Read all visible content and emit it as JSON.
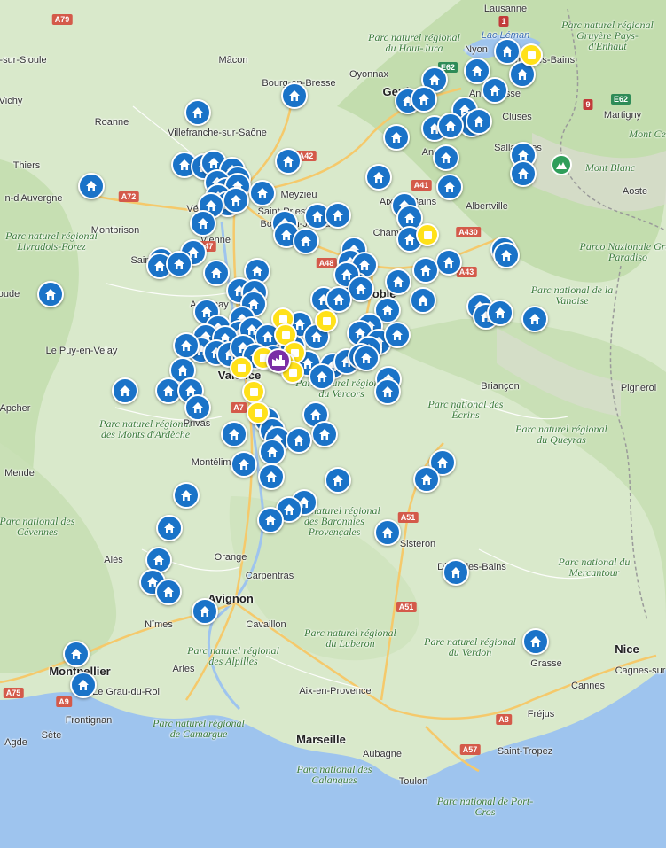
{
  "labels": {
    "lausanne": "Lausanne",
    "nyon": "Nyon",
    "thonon": "Thonon-les-Bains",
    "lac_leman": "Lac Léman",
    "parc_gruyere": "Parc naturel régional Gruyère Pays-d'Enhaut",
    "macon": "Mâcon",
    "oyonnax": "Oyonnax",
    "parc_jura": "Parc naturel régional du Haut-Jura",
    "bourg": "Bourg-en-Bresse",
    "geneve": "Genève",
    "annemasse": "Annemasse",
    "martigny": "Martigny",
    "sioule": "-sur-Sioule",
    "vichy": "Vichy",
    "roanne": "Roanne",
    "villefranche": "Villefranche-sur-Saône",
    "cluses": "Cluses",
    "mont_cervin": "Mont Cerv",
    "thiers": "Thiers",
    "sallanches": "Sallanches",
    "annecy": "Annecy",
    "mont_blanc": "Mont Blanc",
    "meyzieu": "Meyzieu",
    "d_auvergne": "n-d'Auvergne",
    "saint_priest": "Saint-Priest",
    "venissieux": "Vénissieux",
    "aix_bains": "Aix-les-Bains",
    "albertville": "Albertville",
    "aoste": "Aoste",
    "bourgoin": "Bourgoin-Jallieu",
    "parc_livradois": "Parc naturel régional Livradois-Forez",
    "montbrison": "Montbrison",
    "vienne": "Vienne",
    "chambery": "Chambéry",
    "parco_gran": "Parco Nazionale Gran Paradiso",
    "saint_etienne": "Saint",
    "voiron": "Voiron",
    "parc_vanoise": "Parc national de la Vanoise",
    "annonay": "Annonay",
    "grenoble": "Grenoble",
    "le_puy": "Le Puy-en-Velay",
    "parc_vercors": "Parc naturel régional du Vercors",
    "valence": "Valence",
    "briancon": "Briançon",
    "pignerol": "Pignerol",
    "aubenas": "Aubenas",
    "apcher": "Apcher",
    "parc_ardeche": "Parc naturel régional des Monts d'Ardèche",
    "privas": "Privas",
    "parc_ecrins": "Parc national des Écrins",
    "parc_queyras": "Parc naturel régional du Queyras",
    "montelimar": "Montélimar",
    "mende": "Mende",
    "parc_baronnies": "Parc naturel régional des Baronnies Provençales",
    "parc_cevennes": "Parc national des Cévennes",
    "sisteron": "Sisteron",
    "ales": "Alès",
    "orange": "Orange",
    "carpentras": "Carpentras",
    "digne": "Digne-les-Bains",
    "parc_mercantour": "Parc national du Mercantour",
    "avignon": "Avignon",
    "nimes": "Nîmes",
    "cavaillon": "Cavaillon",
    "parc_luberon": "Parc naturel régional du Luberon",
    "parc_verdon": "Parc naturel régional du Verdon",
    "nice": "Nice",
    "montpellier": "Montpellier",
    "parc_alpilles": "Parc naturel régional des Alpilles",
    "arles": "Arles",
    "grasse": "Grasse",
    "cagnes": "Cagnes-sur",
    "aix": "Aix-en-Provence",
    "cannes": "Cannes",
    "grau": "Le Grau-du-Roi",
    "parc_camargue": "Parc naturel régional de Camargue",
    "frejus": "Fréjus",
    "frontignan": "Frontignan",
    "sete": "Sète",
    "agde": "Agde",
    "marseille": "Marseille",
    "aubagne": "Aubagne",
    "saint_tropez": "Saint-Tropez",
    "parc_calanques": "Parc national des Calanques",
    "toulon": "Toulon",
    "parc_portcros": "Parc national de Port-Cros",
    "roude": "oude"
  },
  "roads": {
    "A79": "A79",
    "A42": "A42",
    "A72": "A72",
    "A47": "A47",
    "A48": "A48",
    "A41": "A41",
    "A430": "A430",
    "A43": "A43",
    "A7": "A7",
    "A51": "A51",
    "A51b": "A51",
    "A8": "A8",
    "A57": "A57",
    "A75": "A75",
    "A9": "A9",
    "E62": "E62",
    "E62b": "E62",
    "r1": "1",
    "r9": "9",
    "r48": "A48"
  },
  "colors": {
    "land": "#d7e8c9",
    "forest": "#bcd9a8",
    "water": "#9ec4ee",
    "house_pin": "#1a73c8",
    "event_pin": "#ffe11a",
    "factory_pin": "#7a2ea6"
  },
  "markers": {
    "house_icon": "house-icon",
    "event_icon": "square-icon",
    "factory_icon": "factory-icon",
    "mountain_icon": "mountain-icon"
  }
}
